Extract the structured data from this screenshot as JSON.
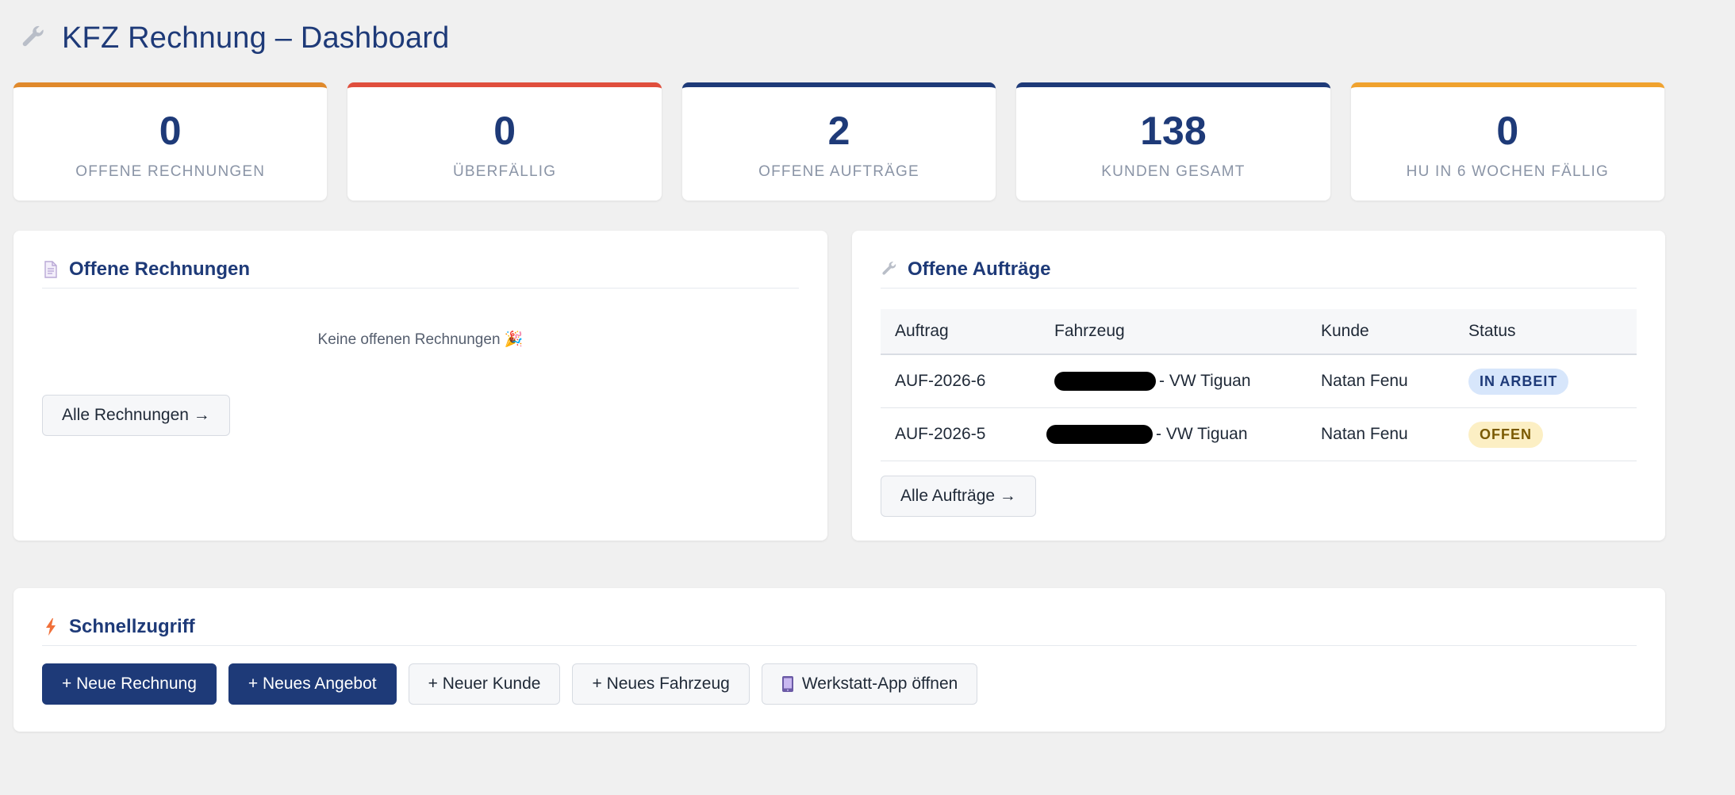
{
  "header": {
    "title": "KFZ Rechnung – Dashboard",
    "icon": "wrench-icon"
  },
  "stats": [
    {
      "value": "0",
      "label": "OFFENE RECHNUNGEN",
      "accent": "#e0892b"
    },
    {
      "value": "0",
      "label": "ÜBERFÄLLIG",
      "accent": "#e04e3c"
    },
    {
      "value": "2",
      "label": "OFFENE AUFTRÄGE",
      "accent": "#1e3a78"
    },
    {
      "value": "138",
      "label": "KUNDEN GESAMT",
      "accent": "#1e3a78"
    },
    {
      "value": "0",
      "label": "HU IN 6 WOCHEN FÄLLIG",
      "accent": "#f0a22e"
    }
  ],
  "invoices_panel": {
    "title": "Offene Rechnungen",
    "empty_message": "Keine offenen Rechnungen 🎉",
    "all_button": "Alle Rechnungen →"
  },
  "orders_panel": {
    "title": "Offene Aufträge",
    "columns": [
      "Auftrag",
      "Fahrzeug",
      "Kunde",
      "Status"
    ],
    "rows": [
      {
        "order": "AUF-2026-6",
        "vehicle": "- VW Tiguan",
        "customer": "Natan Fenu",
        "status": "IN ARBEIT"
      },
      {
        "order": "AUF-2026-5",
        "vehicle": "- VW Tiguan",
        "customer": "Natan Fenu",
        "status": "OFFEN"
      }
    ],
    "all_button": "Alle Aufträge →"
  },
  "quick_panel": {
    "title": "Schnellzugriff",
    "buttons": {
      "new_invoice": "+ Neue Rechnung",
      "new_offer": "+ Neues Angebot",
      "new_customer": "+ Neuer Kunde",
      "new_vehicle": "+ Neues Fahrzeug",
      "workshop_app": "Werkstatt-App öffnen"
    }
  },
  "colors": {
    "primary": "#1e3a78",
    "background": "#f0f0f0",
    "status_in_progress": "#d7e6fb",
    "status_open": "#fcefc4"
  }
}
